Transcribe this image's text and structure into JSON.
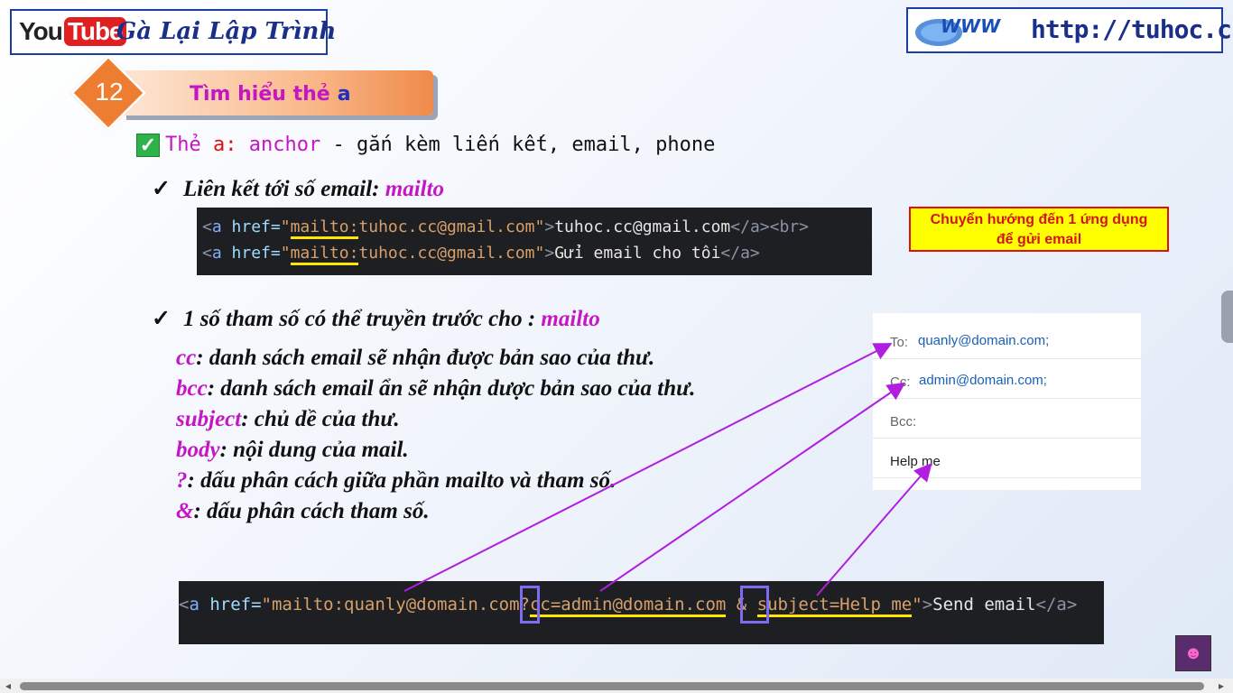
{
  "header": {
    "youtube_you": "You",
    "youtube_tube": "Tube",
    "channel_name": "Gà Lại Lập Trình",
    "site_url": "http://tuhoc.cc"
  },
  "lesson": {
    "number": "12",
    "title": "Tìm hiểu thẻ",
    "title_tag": "a"
  },
  "heading": {
    "the": "Thẻ",
    "a": "a:",
    "anchor": "anchor",
    "rest": " - gắn kèm liến kết, email, phone"
  },
  "section1": {
    "check": "✓",
    "text": "Liên kết tới số email: ",
    "keyword": "mailto"
  },
  "code1": {
    "line1": {
      "open": "<",
      "tag": "a",
      "attr": " href=",
      "q1": "\"",
      "mailto": "mailto:",
      "addr": "tuhoc.cc@gmail.com",
      "q2": "\"",
      "close": ">",
      "text": "tuhoc.cc@gmail.com",
      "end": "</a><br>"
    },
    "line2": {
      "open": "<",
      "tag": "a",
      "attr": " href=",
      "q1": "\"",
      "mailto": "mailto:",
      "addr": "tuhoc.cc@gmail.com",
      "q2": "\"",
      "close": ">",
      "text": "Gửi email cho tôi",
      "end": "</a>"
    }
  },
  "note": {
    "line1": "Chuyển hướng đến 1 ứng dụng",
    "line2": "để gửi email"
  },
  "section2": {
    "check": "✓",
    "text": "1 số tham số có thể truyền trước cho  : ",
    "keyword": "mailto"
  },
  "params": [
    {
      "key": "cc",
      "desc": ": danh sách email sẽ nhận được bản sao của thư."
    },
    {
      "key": "bcc",
      "desc": ": danh sách email ẩn sẽ nhận dược bản sao của thư."
    },
    {
      "key": "subject",
      "desc": ": chủ dề của thư."
    },
    {
      "key": "body",
      "desc": ": nội dung của mail."
    },
    {
      "key": "?",
      "desc": ": dấu phân cách giữa phần mailto và tham số."
    },
    {
      "key": "&",
      "desc": ": dấu phân cách tham số."
    }
  ],
  "email_panel": {
    "to_label": "To:",
    "to_value": "quanly@domain.com;",
    "cc_label": "Cc:",
    "cc_value": "admin@domain.com;",
    "bcc_label": "Bcc:",
    "body_value": "Help me"
  },
  "code2": {
    "open": "<",
    "tag": "a",
    "attr": " href=",
    "str1": "\"mailto:quanly@domain.com",
    "q": "?",
    "cc": "cc=admin@domain.com",
    "amp": " & ",
    "subject": "subject=Help me",
    "q2": "\"",
    "close": ">",
    "text": "Send email",
    "end": "</a>"
  },
  "colors": {
    "accent_pink": "#c416c4",
    "brand_blue": "#1a2f8a",
    "diamond_orange": "#ed7d31",
    "arrow_purple": "#b01ee0",
    "highlight_yellow": "#ffe600"
  }
}
